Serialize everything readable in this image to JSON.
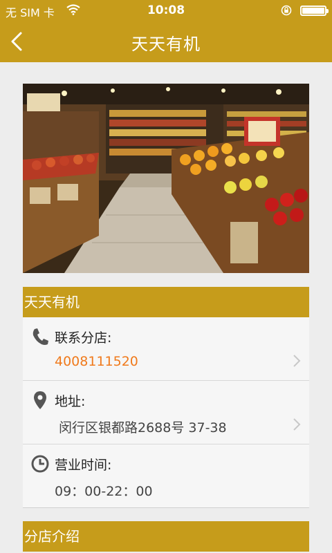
{
  "status_bar": {
    "carrier": "无 SIM 卡",
    "time": "10:08"
  },
  "nav": {
    "title": "天天有机"
  },
  "store": {
    "name_header": "天天有机",
    "contact_label": "联系分店:",
    "phone": "4008111520",
    "address_label": "地址:",
    "address": "闵行区银都路2688号 37-38",
    "hours_label": "营业时间:",
    "hours": "09：00-22：00"
  },
  "intro": {
    "header": "分店介绍"
  },
  "colors": {
    "brand": "#c69c1b",
    "phone_accent": "#f07a1c"
  },
  "icons": {
    "back": "chevron-left",
    "phone": "phone",
    "address": "map-pin",
    "hours": "clock",
    "row_arrow": "chevron-right"
  }
}
